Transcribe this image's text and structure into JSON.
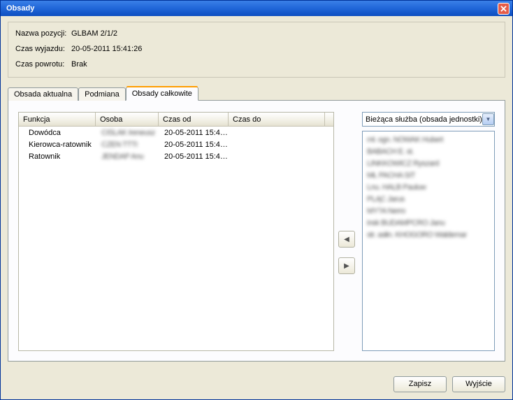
{
  "window": {
    "title": "Obsady"
  },
  "info": {
    "labels": {
      "position": "Nazwa pozycji:",
      "departure": "Czas wyjazdu:",
      "return": "Czas powrotu:"
    },
    "values": {
      "position": "GLBAM 2/1/2",
      "departure": "20-05-2011 15:41:26",
      "return": "Brak"
    }
  },
  "tabs": {
    "items": [
      {
        "label": "Obsada aktualna"
      },
      {
        "label": "Podmiana"
      },
      {
        "label": "Obsady całkowite"
      }
    ],
    "active": 2
  },
  "grid": {
    "columns": {
      "fn": "Funkcja",
      "os": "Osoba",
      "co": "Czas od",
      "cd": "Czas do"
    },
    "rows": [
      {
        "fn": "Dowódca",
        "os": "CIŚLAK Ireneusz",
        "co": "20-05-2011 15:4…",
        "cd": ""
      },
      {
        "fn": "Kierowca-ratownik",
        "os": "CZEN TTTI",
        "co": "20-05-2011 15:4…",
        "cd": ""
      },
      {
        "fn": "Ratownik",
        "os": "JENDAP Anu",
        "co": "20-05-2011 15:4…",
        "cd": ""
      }
    ]
  },
  "arrows": {
    "left_glyph": "◀",
    "right_glyph": "▶"
  },
  "right": {
    "combo": "Bieżąca służba (obsada jednostki)",
    "list": [
      "mł. ogn. NOWAK Hubert",
      "BABACH E. st.",
      "LINKKOWICZ  Ryszard",
      "MŁ PACHA SIT",
      "Lnu. HALB Pauluw",
      "PLĄC  Jarus",
      "MY?A  Nerro",
      "insk BUDAMPCRO Janu",
      "str. asłin. KHOGORO Waldemar"
    ]
  },
  "footer": {
    "save": "Zapisz",
    "exit": "Wyjście"
  }
}
